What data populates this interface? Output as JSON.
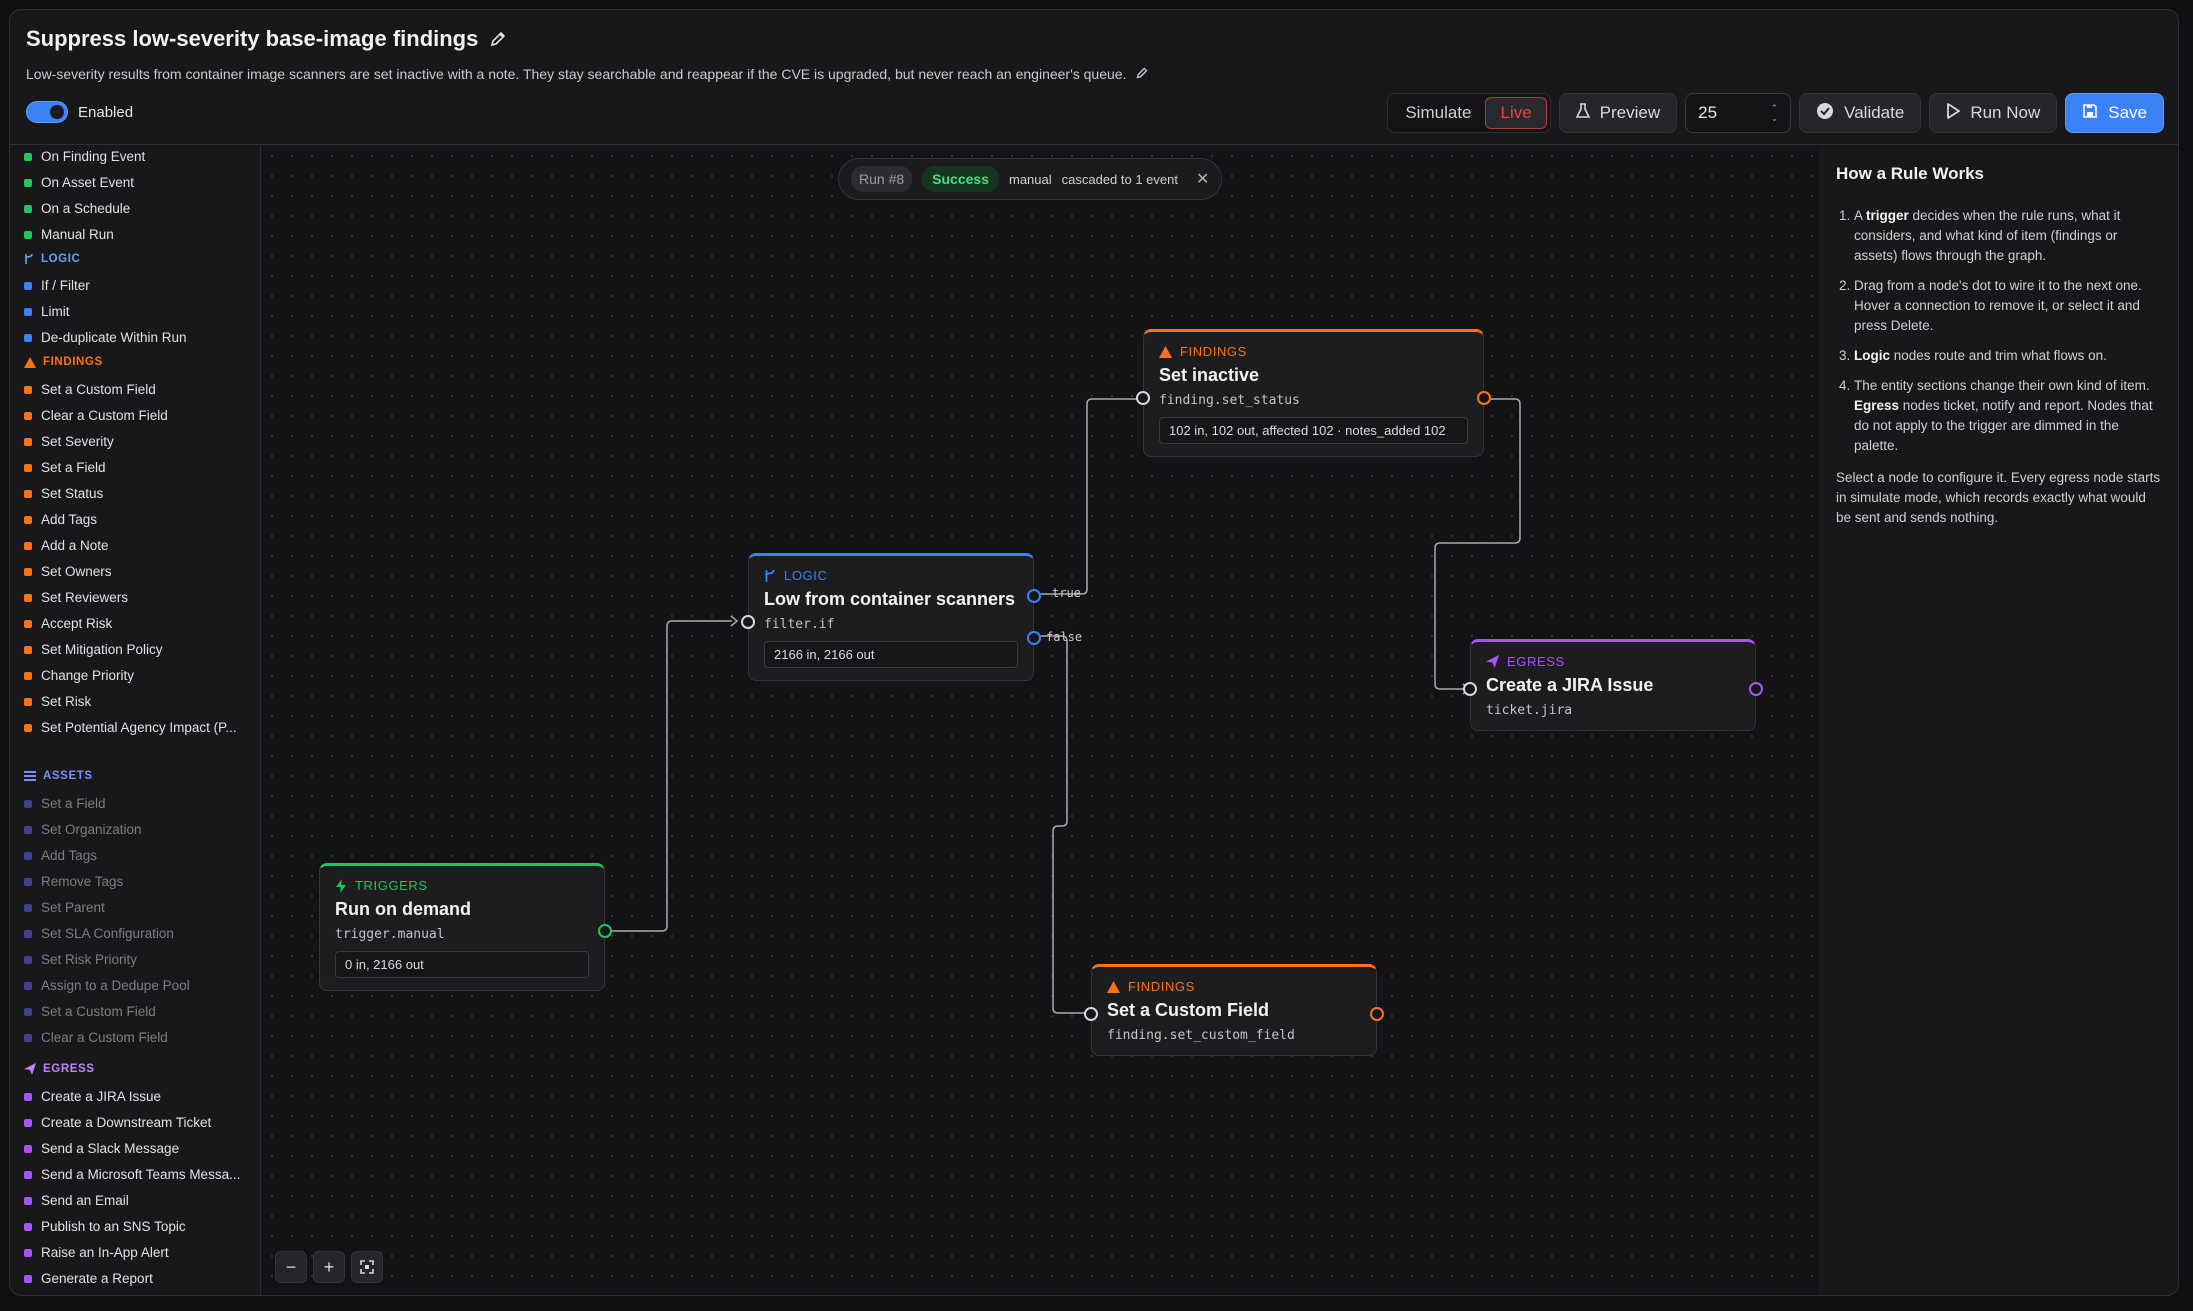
{
  "header": {
    "title": "Suppress low-severity base-image findings",
    "description": "Low-severity results from container image scanners are set inactive with a note. They stay searchable and reappear if the CVE is upgraded, but never reach an engineer's queue.",
    "enabled_label": "Enabled",
    "enabled": true
  },
  "toolbar": {
    "simulate_label": "Simulate",
    "live_label": "Live",
    "preview_label": "Preview",
    "preview_count": "25",
    "validate_label": "Validate",
    "run_now_label": "Run Now",
    "save_label": "Save"
  },
  "colors": {
    "triggers": "#22c55e",
    "logic": "#3b82f6",
    "findings": "#f97316",
    "assets": "#6366f1",
    "egress": "#a855f7",
    "accent": "#3b82f6"
  },
  "palette": {
    "triggers": {
      "items": [
        "On Finding Event",
        "On Asset Event",
        "On a Schedule",
        "Manual Run"
      ]
    },
    "logic": {
      "label": "LOGIC",
      "items": [
        "If / Filter",
        "Limit",
        "De-duplicate Within Run"
      ]
    },
    "findings": {
      "label": "FINDINGS",
      "items": [
        "Set a Custom Field",
        "Clear a Custom Field",
        "Set Severity",
        "Set a Field",
        "Set Status",
        "Add Tags",
        "Add a Note",
        "Set Owners",
        "Set Reviewers",
        "Accept Risk",
        "Set Mitigation Policy",
        "Change Priority",
        "Set Risk",
        "Set Potential Agency Impact (P..."
      ]
    },
    "assets": {
      "label": "ASSETS",
      "items": [
        "Set a Field",
        "Set Organization",
        "Add Tags",
        "Remove Tags",
        "Set Parent",
        "Set SLA Configuration",
        "Set Risk Priority",
        "Assign to a Dedupe Pool",
        "Set a Custom Field",
        "Clear a Custom Field"
      ]
    },
    "egress": {
      "label": "EGRESS",
      "items": [
        "Create a JIRA Issue",
        "Create a Downstream Ticket",
        "Send a Slack Message",
        "Send a Microsoft Teams Messa...",
        "Send an Email",
        "Publish to an SNS Topic",
        "Raise an In-App Alert",
        "Generate a Report"
      ]
    }
  },
  "run": {
    "id": "Run #8",
    "status": "Success",
    "mode": "manual",
    "cascade": "cascaded to 1 event"
  },
  "nodes": {
    "trigger": {
      "kind": "TRIGGERS",
      "title": "Run on demand",
      "type": "trigger.manual",
      "stats": "0 in, 2166 out"
    },
    "filter": {
      "kind": "LOGIC",
      "title": "Low from container scanners",
      "type": "filter.if",
      "stats": "2166 in, 2166 out",
      "true_label": "true",
      "false_label": "false"
    },
    "set_inactive": {
      "kind": "FINDINGS",
      "title": "Set inactive",
      "type": "finding.set_status",
      "stats": "102 in, 102 out, affected 102 · notes_added 102"
    },
    "jira": {
      "kind": "EGRESS",
      "title": "Create a JIRA Issue",
      "type": "ticket.jira"
    },
    "custom_field": {
      "kind": "FINDINGS",
      "title": "Set a Custom Field",
      "type": "finding.set_custom_field"
    }
  },
  "zoom": {
    "out": "−",
    "in": "+",
    "fit": "⌘"
  },
  "help": {
    "title": "How a Rule Works",
    "steps": [
      {
        "pre": "A ",
        "bold": "trigger",
        "post": " decides when the rule runs, what it considers, and what kind of item (findings or assets) flows through the graph."
      },
      {
        "pre": "Drag from a node's dot to wire it to the next one. Hover a connection to remove it, or select it and press Delete.",
        "bold": "",
        "post": ""
      },
      {
        "pre": "",
        "bold": "Logic",
        "post": " nodes route and trim what flows on."
      },
      {
        "pre": "The entity sections change their own kind of item. ",
        "bold": "Egress",
        "post": " nodes ticket, notify and report. Nodes that do not apply to the trigger are dimmed in the palette."
      }
    ],
    "footer": "Select a node to configure it. Every egress node starts in simulate mode, which records exactly what would be sent and sends nothing."
  }
}
